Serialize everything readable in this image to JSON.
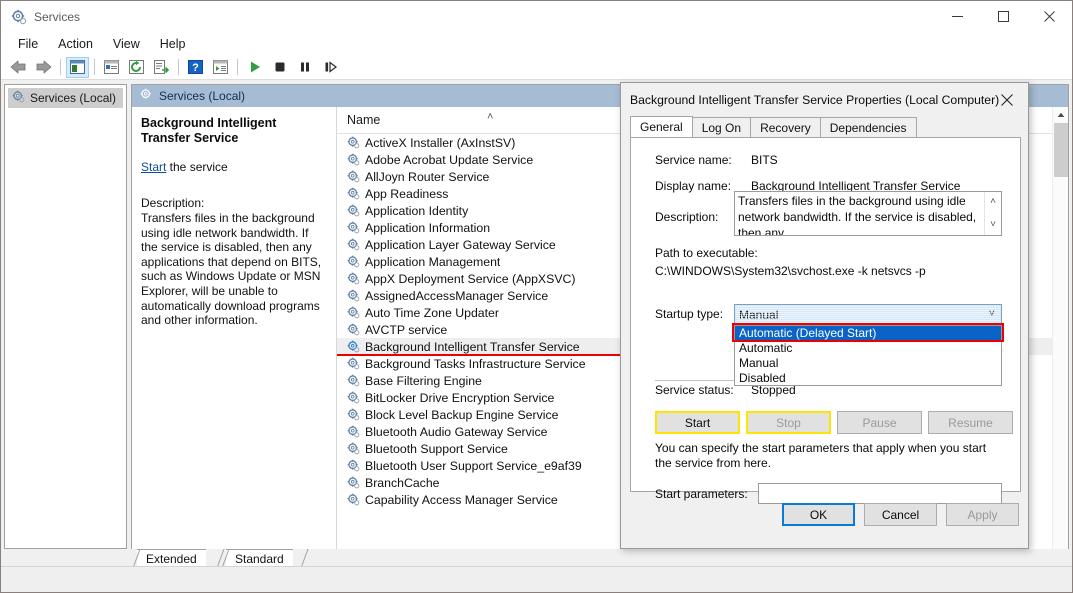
{
  "window": {
    "title": "Services",
    "title_icon": "services-gear-icon",
    "minimize": "—",
    "maximize": "□",
    "close": "✕"
  },
  "menu": {
    "items": [
      {
        "label": "File"
      },
      {
        "label": "Action"
      },
      {
        "label": "View"
      },
      {
        "label": "Help"
      }
    ]
  },
  "toolbar": {
    "buttons": [
      {
        "name": "back-icon",
        "glyph": "⬅"
      },
      {
        "name": "forward-icon",
        "glyph": "➡"
      },
      {
        "name": "show-hide-tree-icon",
        "glyph": "▤"
      },
      {
        "name": "properties-icon",
        "glyph": "▤"
      },
      {
        "name": "refresh-icon",
        "glyph": "↻"
      },
      {
        "name": "export-list-icon",
        "glyph": "☰"
      },
      {
        "name": "help-icon",
        "glyph": "?"
      },
      {
        "name": "show-action-pane-icon",
        "glyph": "▤"
      },
      {
        "name": "start-service-icon",
        "glyph": "▶"
      },
      {
        "name": "stop-service-icon",
        "glyph": "■"
      },
      {
        "name": "pause-service-icon",
        "glyph": "‖"
      },
      {
        "name": "restart-service-icon",
        "glyph": "⏭"
      }
    ]
  },
  "tree": {
    "root_label": "Services (Local)"
  },
  "right_pane": {
    "header_label": "Services (Local)"
  },
  "detail": {
    "title": "Background Intelligent Transfer Service",
    "action_link": "Start",
    "action_suffix": " the service",
    "description_label": "Description:",
    "description": "Transfers files in the background using idle network bandwidth. If the service is disabled, then any applications that depend on BITS, such as Windows Update or MSN Explorer, will be unable to automatically download programs and other information."
  },
  "list": {
    "column_header": "Name",
    "sort_indicator": "˄",
    "selected_index": 12,
    "rows": [
      {
        "label": "ActiveX Installer (AxInstSV)"
      },
      {
        "label": "Adobe Acrobat Update Service"
      },
      {
        "label": "AllJoyn Router Service"
      },
      {
        "label": "App Readiness"
      },
      {
        "label": "Application Identity"
      },
      {
        "label": "Application Information"
      },
      {
        "label": "Application Layer Gateway Service"
      },
      {
        "label": "Application Management"
      },
      {
        "label": "AppX Deployment Service (AppXSVC)"
      },
      {
        "label": "AssignedAccessManager Service"
      },
      {
        "label": "Auto Time Zone Updater"
      },
      {
        "label": "AVCTP service"
      },
      {
        "label": "Background Intelligent Transfer Service"
      },
      {
        "label": "Background Tasks Infrastructure Service"
      },
      {
        "label": "Base Filtering Engine"
      },
      {
        "label": "BitLocker Drive Encryption Service"
      },
      {
        "label": "Block Level Backup Engine Service"
      },
      {
        "label": "Bluetooth Audio Gateway Service"
      },
      {
        "label": "Bluetooth Support Service"
      },
      {
        "label": "Bluetooth User Support Service_e9af39"
      },
      {
        "label": "BranchCache"
      },
      {
        "label": "Capability Access Manager Service"
      }
    ]
  },
  "bottom_tabs": [
    {
      "label": "Extended"
    },
    {
      "label": "Standard"
    }
  ],
  "dialog": {
    "title": "Background Intelligent Transfer Service Properties (Local Computer)",
    "close_glyph": "✕",
    "tabs": [
      {
        "label": "General",
        "active": true
      },
      {
        "label": "Log On",
        "active": false
      },
      {
        "label": "Recovery",
        "active": false
      },
      {
        "label": "Dependencies",
        "active": false
      }
    ],
    "service_name_label": "Service name:",
    "service_name_value": "BITS",
    "display_name_label": "Display name:",
    "display_name_value": "Background Intelligent Transfer Service",
    "description_label": "Description:",
    "description_value": "Transfers files in the background using idle network bandwidth. If the service is disabled, then any",
    "scroll_up_glyph": "˄",
    "scroll_down_glyph": "˅",
    "path_label": "Path to executable:",
    "path_value": "C:\\WINDOWS\\System32\\svchost.exe -k netsvcs -p",
    "startup_type_label": "Startup type:",
    "startup_type_value": "Manual",
    "combo_chevron": "˅",
    "startup_options": [
      {
        "label": "Automatic (Delayed Start)",
        "highlighted": true
      },
      {
        "label": "Automatic",
        "highlighted": false
      },
      {
        "label": "Manual",
        "highlighted": false
      },
      {
        "label": "Disabled",
        "highlighted": false
      }
    ],
    "service_status_label": "Service status:",
    "service_status_value": "Stopped",
    "control_buttons": [
      {
        "label": "Start",
        "enabled": true,
        "annotated": true
      },
      {
        "label": "Stop",
        "enabled": false,
        "annotated": true
      },
      {
        "label": "Pause",
        "enabled": false,
        "annotated": false
      },
      {
        "label": "Resume",
        "enabled": false,
        "annotated": false
      }
    ],
    "hint_text": "You can specify the start parameters that apply when you start the service from here.",
    "start_params_label": "Start parameters:",
    "start_params_value": "",
    "footer_buttons": [
      {
        "label": "OK",
        "enabled": true,
        "is_default": true
      },
      {
        "label": "Cancel",
        "enabled": true,
        "is_default": false
      },
      {
        "label": "Apply",
        "enabled": false,
        "is_default": false
      }
    ]
  },
  "colors": {
    "annotation_red": "#ef0000",
    "annotation_yellow": "#ffe400",
    "selection_blue": "#0a64c8",
    "default_button_blue": "#0a7ad6",
    "pane_header_blue": "#a5bcd4"
  }
}
